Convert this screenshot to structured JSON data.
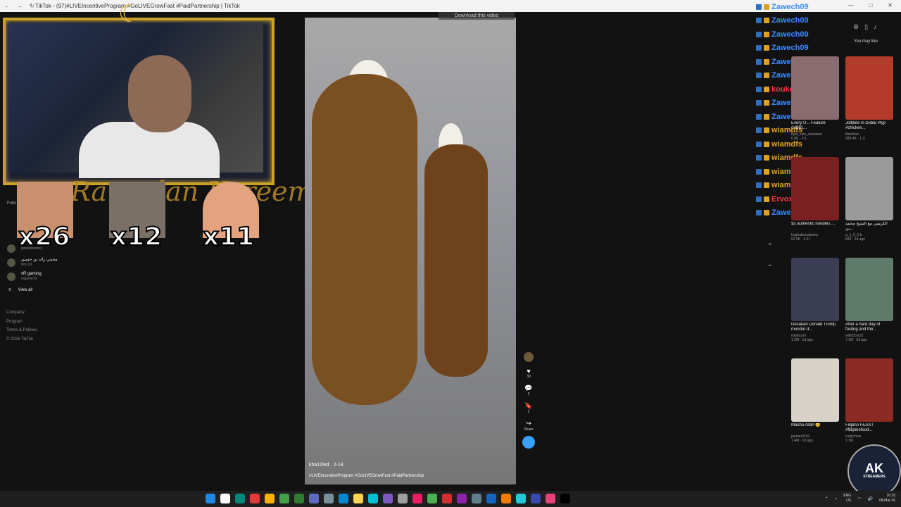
{
  "browser": {
    "tab_title": "TikTok - (97)#LIVEIncentiveProgram #GoLIVEGrowFast #PaidPartnership | TikTok",
    "nav": [
      "←",
      "→",
      "↻"
    ],
    "window_controls": [
      "—",
      "□",
      "✕"
    ]
  },
  "stream_overlay": {
    "banner_text": "Ramadan Kareem",
    "emote_counts": [
      "x26",
      "x12",
      "x11"
    ]
  },
  "left_nav": {
    "following_header": "Follo",
    "accounts": [
      {
        "name": "",
        "handle": "paradaristoss"
      },
      {
        "name": "محمي رائد بن حسين",
        "handle": "rtot.111"
      },
      {
        "name": "vR gaming",
        "handle": "vrgame19"
      }
    ],
    "view_all": "View all",
    "footer": [
      "Company",
      "Program",
      "Terms & Policies",
      "© 2026 TikTok"
    ]
  },
  "video": {
    "download_label": "Download this video",
    "author": "kha12led · 2-18",
    "tags": "#LIVEIncentiveProgram #GoLIVEGrowFast #PaidPartnership",
    "actions": [
      {
        "icon": "heart-icon",
        "glyph": "♥",
        "count": "30"
      },
      {
        "icon": "comment-icon",
        "glyph": "💬",
        "count": "2"
      },
      {
        "icon": "bookmark-icon",
        "glyph": "🔖",
        "count": "2"
      },
      {
        "icon": "share-icon",
        "glyph": "↪",
        "count": "Share"
      }
    ]
  },
  "chat": {
    "rows": [
      {
        "user": "Zawech09",
        "color": "#3d8bff"
      },
      {
        "user": "Zawech09",
        "color": "#3d8bff"
      },
      {
        "user": "Zawech09",
        "color": "#3d8bff"
      },
      {
        "user": "Zawech09",
        "color": "#3d8bff"
      },
      {
        "user": "Zawech09",
        "color": "#3d8bff"
      },
      {
        "user": "Zawech09",
        "color": "#3d8bff"
      },
      {
        "user": "koukou",
        "color": "#ff3344"
      },
      {
        "user": "Zawech09",
        "color": "#3d8bff"
      },
      {
        "user": "Zawech09",
        "color": "#3d8bff"
      },
      {
        "user": "wiamdfs",
        "color": "#e0a020"
      },
      {
        "user": "wiamdfs",
        "color": "#e0a020"
      },
      {
        "user": "wiamdfs",
        "color": "#e0a020"
      },
      {
        "user": "wiamdfs",
        "color": "#e0a020"
      },
      {
        "user": "wiamd",
        "color": "#e0a020"
      },
      {
        "user": "Ervoxxx :",
        "color": "#ff3344"
      },
      {
        "user": "Zawech09",
        "color": "#3d8bff"
      }
    ]
  },
  "sidebar": {
    "you_may_like": "You may like",
    "cards": [
      {
        "title": "Every U... Feature (HDR)...",
        "author": "byte_size_explainer",
        "stats": "6.9K · 2-1",
        "color": "#8a6b70"
      },
      {
        "title": "Jollibee in Dubai #fyp #chicken...",
        "author": "lifeofclan",
        "stats": "580.4K · 1-3",
        "color": "#b23b2a"
      },
      {
        "title": "$2 authentic noodles ...",
        "author": "hughabroadextra",
        "stats": "62.9K · 2-17",
        "color": "#7a2020"
      },
      {
        "title": "الكرسي مع الشيخ محمد بن...",
        "author": "a_1_0_0.b",
        "stats": "844 · 2d ago",
        "color": "#9a9a9a"
      },
      {
        "title": "Desakan Donald Trump mundur d...",
        "author": "inilahcom",
        "stats": "1.2M · 1d ago",
        "color": "#3b3e52"
      },
      {
        "title": "After a hard day of fasting and the...",
        "author": "wildr3ckr22",
        "stats": "7.1M · 6d ago",
        "color": "#5d7a6b"
      },
      {
        "title": "Masha Allah 😊",
        "author": "jaehan9192",
        "stats": "1.4M · 1d ago",
        "color": "#d8d2c8"
      },
      {
        "title": "Filipino FEAST #fillipinofood...",
        "author": "codychow",
        "stats": "1.1M",
        "color": "#8c2a25"
      }
    ]
  },
  "branding": {
    "logo_text": "AK",
    "logo_sub": "STREAMERS"
  },
  "taskbar": {
    "icon_colors": [
      "#1e88e5",
      "#ffffff",
      "#00897b",
      "#e53935",
      "#ffb300",
      "#43a047",
      "#2e7d32",
      "#5c6bc0",
      "#78909c",
      "#0288d1",
      "#ffd54f",
      "#00bcd4",
      "#7e57c2",
      "#9e9e9e",
      "#e91e63",
      "#4caf50",
      "#d32f2f",
      "#8e24aa",
      "#607d8b",
      "#1565c0",
      "#f57c00",
      "#26c6da",
      "#3949ab",
      "#ec407a",
      "#000000"
    ],
    "lang": "ENG",
    "region": "US",
    "time": "16:18",
    "date": "08-Mar-26"
  }
}
